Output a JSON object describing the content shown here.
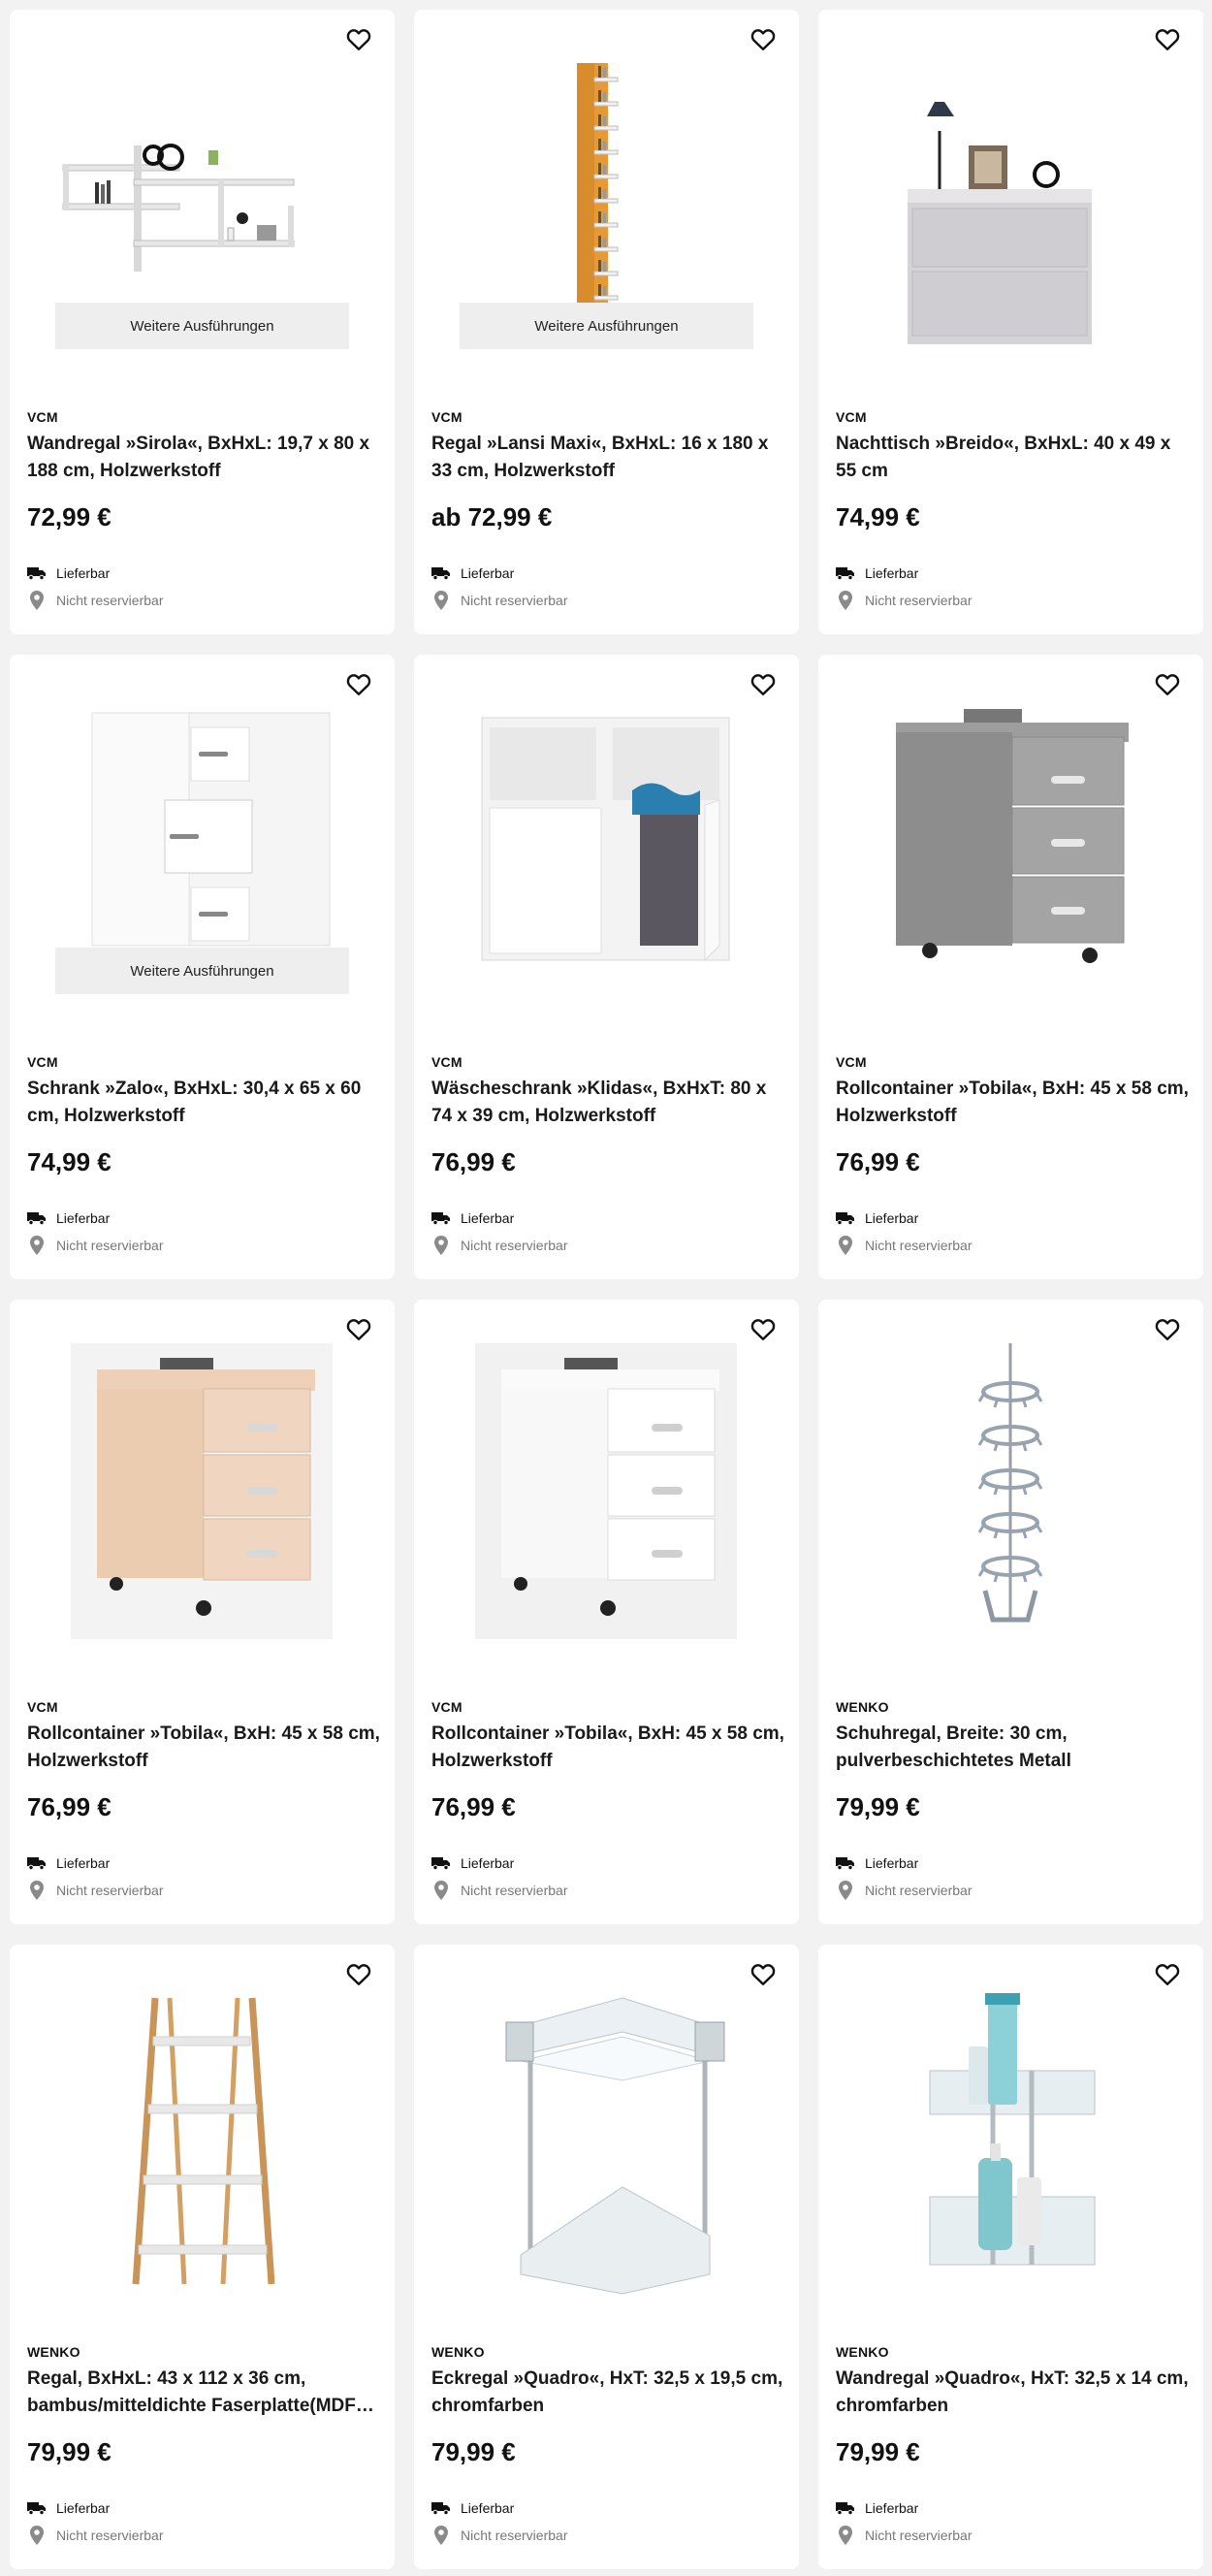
{
  "colors": {
    "background": "#f2f2f2",
    "card": "#ffffff",
    "variants_bg": "#eeeeee",
    "muted": "#777777"
  },
  "products": [
    {
      "brand": "VCM",
      "title": "Wandregal »Sirola«, BxHxL: 19,7 x 80 x 188 cm, Holzwerkstoff",
      "price": "72,99 €",
      "variants": "Weitere Ausführungen",
      "delivery": "Lieferbar",
      "reserve": "Nicht reservierbar",
      "image": "wall-shelf"
    },
    {
      "brand": "VCM",
      "title": "Regal »Lansi Maxi«, BxHxL: 16 x 180 x 33 cm, Holzwerkstoff",
      "price": "ab 72,99 €",
      "variants": "Weitere Ausführungen",
      "delivery": "Lieferbar",
      "reserve": "Nicht reservierbar",
      "image": "tall-shelf"
    },
    {
      "brand": "VCM",
      "title": "Nachttisch »Breido«, BxHxL: 40 x 49 x 55 cm",
      "price": "74,99 €",
      "variants": "",
      "delivery": "Lieferbar",
      "reserve": "Nicht reservierbar",
      "image": "nightstand"
    },
    {
      "brand": "VCM",
      "title": "Schrank »Zalo«, BxHxL: 30,4 x 65 x 60 cm, Holzwerkstoff",
      "price": "74,99 €",
      "variants": "Weitere Ausführungen",
      "delivery": "Lieferbar",
      "reserve": "Nicht reservierbar",
      "image": "cabinet"
    },
    {
      "brand": "VCM",
      "title": "Wäscheschrank »Klidas«, BxHxT: 80 x 74 x 39 cm, Holzwerkstoff",
      "price": "76,99 €",
      "variants": "",
      "delivery": "Lieferbar",
      "reserve": "Nicht reservierbar",
      "image": "laundry-cabinet"
    },
    {
      "brand": "VCM",
      "title": "Rollcontainer »Tobila«, BxH: 45 x 58 cm, Holzwerkstoff",
      "price": "76,99 €",
      "variants": "",
      "delivery": "Lieferbar",
      "reserve": "Nicht reservierbar",
      "image": "container-grey"
    },
    {
      "brand": "VCM",
      "title": "Rollcontainer »Tobila«, BxH: 45 x 58 cm, Holzwerkstoff",
      "price": "76,99 €",
      "variants": "",
      "delivery": "Lieferbar",
      "reserve": "Nicht reservierbar",
      "image": "container-beige"
    },
    {
      "brand": "VCM",
      "title": "Rollcontainer »Tobila«, BxH: 45 x 58 cm, Holzwerkstoff",
      "price": "76,99 €",
      "variants": "",
      "delivery": "Lieferbar",
      "reserve": "Nicht reservierbar",
      "image": "container-white"
    },
    {
      "brand": "WENKO",
      "title": "Schuhregal, Breite: 30 cm, pulverbeschichtetes Metall",
      "price": "79,99 €",
      "variants": "",
      "delivery": "Lieferbar",
      "reserve": "Nicht reservierbar",
      "image": "shoe-rack"
    },
    {
      "brand": "WENKO",
      "title": "Regal, BxHxL: 43 x 112 x 36 cm, bambus/mitteldichte Faserplatte(MDF…",
      "price": "79,99 €",
      "variants": "",
      "delivery": "Lieferbar",
      "reserve": "Nicht reservierbar",
      "image": "ladder-shelf"
    },
    {
      "brand": "WENKO",
      "title": "Eckregal »Quadro«, HxT: 32,5 x 19,5 cm, chromfarben",
      "price": "79,99 €",
      "variants": "",
      "delivery": "Lieferbar",
      "reserve": "Nicht reservierbar",
      "image": "corner-shelf"
    },
    {
      "brand": "WENKO",
      "title": "Wandregal »Quadro«, HxT: 32,5 x 14 cm, chromfarben",
      "price": "79,99 €",
      "variants": "",
      "delivery": "Lieferbar",
      "reserve": "Nicht reservierbar",
      "image": "bath-shelf"
    }
  ]
}
